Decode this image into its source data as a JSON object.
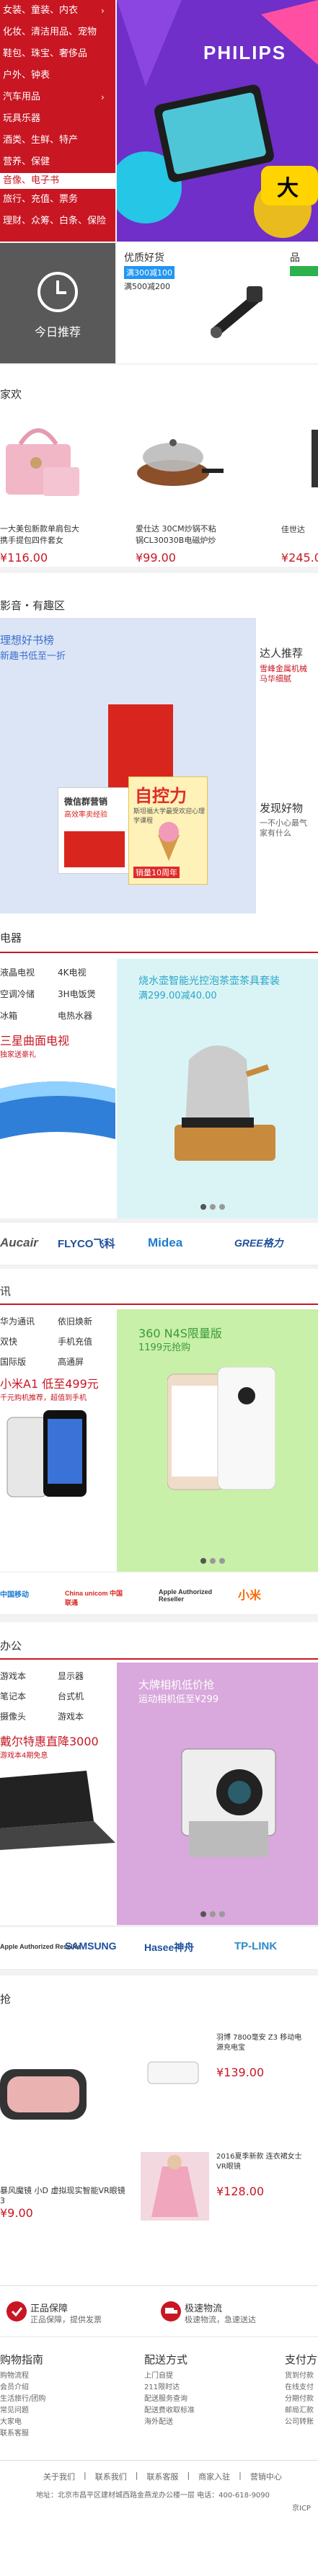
{
  "category_menu": [
    "女装、童装、内衣",
    "化妆、清洁用品、宠物",
    "鞋包、珠宝、奢侈品",
    "户外、钟表",
    "汽车用品",
    "玩具乐器",
    "酒类、生鲜、特产",
    "营养、保健"
  ],
  "category_highlight": "音像、电子书",
  "category_menu_2": [
    "旅行、充值、票务",
    "理财、众筹、白条、保险"
  ],
  "hero": {
    "brand": "PHILIPS",
    "tag": "大"
  },
  "today": {
    "label": "今日推荐"
  },
  "deal": {
    "title": "优质好货",
    "promo1": "满300减100",
    "promo2": "满500减200",
    "title2": "品"
  },
  "floor1": {
    "title": "家欢",
    "items": [
      {
        "name": "一大美包新款单肩包大\n携手提包四件套女",
        "price": "¥116.00"
      },
      {
        "name": "爱仕达 30CM炒锅不粘\n锅CL30030B电磁炉炒",
        "price": "¥99.00"
      },
      {
        "name": "佳世达",
        "price": "¥245.0"
      }
    ]
  },
  "floor2": {
    "title": "影音・有趣区",
    "banner_text": [
      "理想好书榜",
      "新趣书低至一折"
    ],
    "book1": "自控力",
    "book1_sub": "斯坦福大学最受欢迎心理学课程",
    "book1_badge": "销量10周年",
    "book2": "微信群营销",
    "book2_sub": "高效率卖经验",
    "side1_title": "达人推荐",
    "side1_sub": "雪峰金属机械\n马华细腻",
    "side2_title": "发现好物",
    "side2_sub": "一不小心最气\n家有什么"
  },
  "floor3": {
    "title": "电器",
    "tags": [
      "液晶电视",
      "4K电视",
      "空调冷储",
      "3H电饭煲",
      "冰箱",
      "电热水器"
    ],
    "sub_title": "三星曲面电视",
    "sub_sub": "独家送豪礼",
    "ad_title": "烧水壶智能光控泡茶壶茶具套装",
    "ad_sub": "满299.00减40.00"
  },
  "brands1": [
    "Aucair",
    "FLYCO飞科",
    "Midea",
    "GREE格力"
  ],
  "floor4": {
    "title": "讯",
    "tags": [
      "华为通讯",
      "依旧焕新",
      "双快",
      "手机充值",
      "国际版",
      "高通屏"
    ],
    "sub_title": "小米A1 低至499元",
    "sub_sub": "千元购机推荐，超值到手机",
    "ad_title": "360 N4S限量版",
    "ad_sub": "1199元抢购"
  },
  "brands2": [
    "中国移动",
    "China unicom 中国联通",
    "Apple Authorized Reseller",
    "小米"
  ],
  "floor5": {
    "title": "办公",
    "tags": [
      "游戏本",
      "显示器",
      "笔记本",
      "台式机",
      "摄像头",
      "游戏本"
    ],
    "sub_title": "戴尔特惠直降3000",
    "sub_sub": "游戏本4期免息",
    "ad_title": "大牌相机低价抢",
    "ad_sub": "运动相机低至¥299"
  },
  "brands3": [
    "Apple Authorized Reseller",
    "SAMSUNG",
    "Hasee神舟",
    "TP-LINK"
  ],
  "floor6": {
    "title": "抢",
    "items": [
      {
        "name": "暴风魔镜 小D 虚拟现实智能VR眼镜3",
        "price": "¥9.00"
      },
      {
        "name": "羽博 7800毫安 Z3 移动电源充电宝",
        "price": "¥139.00"
      },
      {
        "name": "2016夏季新款 连衣裙女士VR眼镜",
        "price": "¥128.00"
      }
    ]
  },
  "guarantees": [
    {
      "title": "正品保障",
      "sub": "正品保障，提供发票"
    },
    {
      "title": "极速物流",
      "sub": "极速物流，急速送达"
    }
  ],
  "footer_cols": [
    {
      "title": "购物指南",
      "items": [
        "购物流程",
        "会员介绍",
        "生活旅行/团购",
        "常见问题",
        "大家电",
        "联系客服"
      ]
    },
    {
      "title": "配送方式",
      "items": [
        "上门自提",
        "211限时达",
        "配送服务查询",
        "配送费收取标准",
        "海外配送"
      ]
    },
    {
      "title": "支付方式",
      "items": [
        "货到付款",
        "在线支付",
        "分期付款",
        "邮局汇款",
        "公司转账"
      ]
    }
  ],
  "footer_links": [
    "关于我们",
    "联系我们",
    "联系客服",
    "商家入驻",
    "营销中心"
  ],
  "footer_addr": "地址：北京市昌平区建材城西路金燕龙办公楼一层   电话：400-618-9090",
  "footer_more": "京ICP"
}
